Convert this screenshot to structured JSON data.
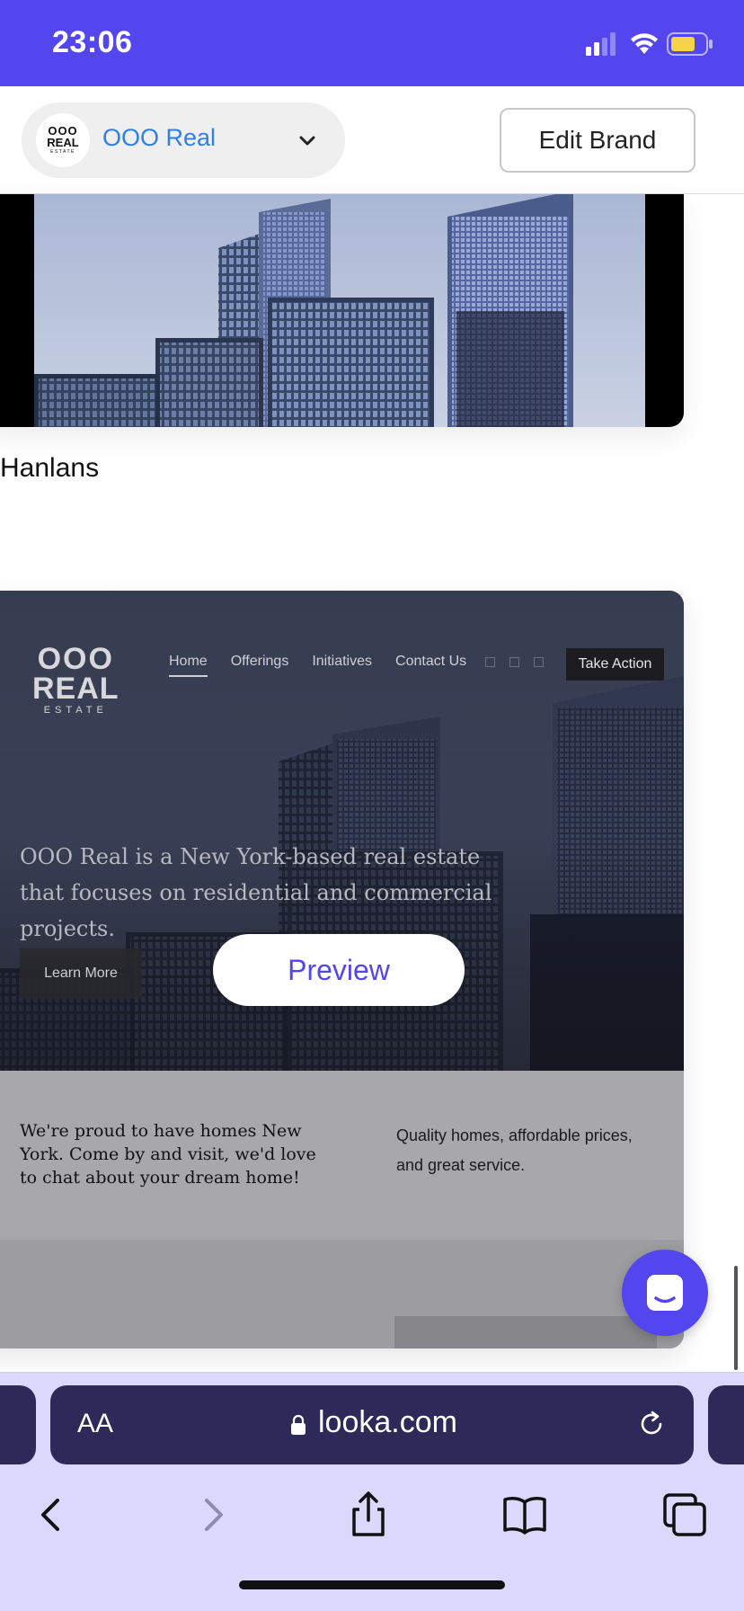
{
  "status_bar": {
    "time": "23:06"
  },
  "brand_header": {
    "brand_name": "OOO Real",
    "logo_line1": "OOO",
    "logo_line2": "REAL",
    "logo_line3": "ESTATE",
    "edit_button": "Edit Brand"
  },
  "cards": [
    {
      "title": "Hanlans"
    },
    {
      "site_logo": {
        "line1": "OOO",
        "line2": "REAL",
        "line3": "ESTATE"
      },
      "nav": [
        "Home",
        "Offerings",
        "Initiatives",
        "Contact Us"
      ],
      "cta": "Take Action",
      "hero_text": "OOO Real is a New York-based real estate that focuses on residential and commercial projects.",
      "learn_more": "Learn More",
      "preview_label": "Preview",
      "about_left": "We're proud to have homes New York. Come by and visit, we'd love to chat about your dream home!",
      "about_right": "Quality homes, affordable prices, and great service."
    }
  ],
  "browser": {
    "text_size_label": "AA",
    "url": "looka.com"
  },
  "colors": {
    "accent": "#5346ee",
    "link": "#2f7fe8",
    "browser_bar": "#2d2a5a",
    "browser_bg": "#dcd8fd"
  }
}
